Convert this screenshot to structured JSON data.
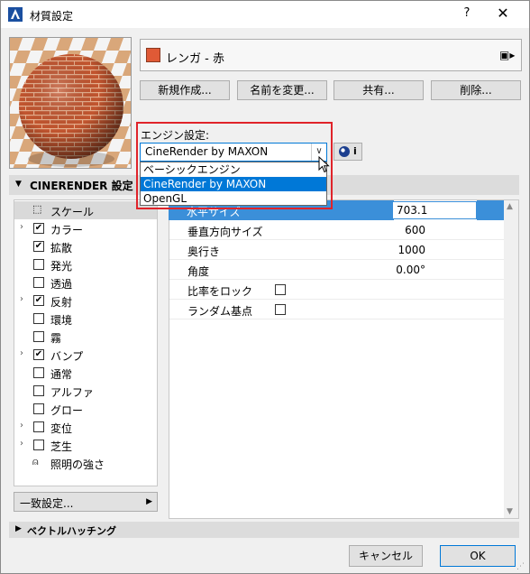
{
  "window": {
    "title": "材質設定",
    "help_label": "?",
    "close_label": "✕"
  },
  "material": {
    "name": "レンガ - 赤",
    "swatch_color": "#e05a36",
    "library_icon": "library-icon"
  },
  "buttons": {
    "new": "新規作成...",
    "rename": "名前を変更...",
    "share": "共有...",
    "delete": "削除..."
  },
  "engine": {
    "label": "エンジン設定:",
    "selected": "CineRender by MAXON",
    "options": [
      "ベーシックエンジン",
      "CineRender by MAXON",
      "OpenGL"
    ],
    "selected_index": 1,
    "info_label": "i"
  },
  "section": {
    "title": "CINERENDER 設定"
  },
  "channels": [
    {
      "label": "スケール",
      "expandable": false,
      "checked": null,
      "selected": true,
      "icon": "scale-icon"
    },
    {
      "label": "カラー",
      "expandable": true,
      "checked": true
    },
    {
      "label": "拡散",
      "expandable": false,
      "checked": true
    },
    {
      "label": "発光",
      "expandable": false,
      "checked": false
    },
    {
      "label": "透過",
      "expandable": false,
      "checked": false
    },
    {
      "label": "反射",
      "expandable": true,
      "checked": true
    },
    {
      "label": "環境",
      "expandable": false,
      "checked": false
    },
    {
      "label": "霧",
      "expandable": false,
      "checked": false
    },
    {
      "label": "バンプ",
      "expandable": true,
      "checked": true
    },
    {
      "label": "通常",
      "expandable": false,
      "checked": false
    },
    {
      "label": "アルファ",
      "expandable": false,
      "checked": false
    },
    {
      "label": "グロー",
      "expandable": false,
      "checked": false
    },
    {
      "label": "変位",
      "expandable": true,
      "checked": false
    },
    {
      "label": "芝生",
      "expandable": true,
      "checked": false
    },
    {
      "label": "照明の強さ",
      "expandable": false,
      "checked": null,
      "icon": "light-icon"
    }
  ],
  "params": {
    "editing": {
      "label": "水平サイズ",
      "value": "703.1"
    },
    "rows": [
      {
        "label": "垂直方向サイズ",
        "value": "600"
      },
      {
        "label": "奥行き",
        "value": "1000"
      },
      {
        "label": "角度",
        "value": "0.00°"
      },
      {
        "label": "比率をロック",
        "checkbox": true
      },
      {
        "label": "ランダム基点",
        "checkbox": true
      }
    ]
  },
  "match_settings": "一致設定...",
  "vector_section": "ベクトルハッチング",
  "footer": {
    "cancel": "キャンセル",
    "ok": "OK"
  }
}
